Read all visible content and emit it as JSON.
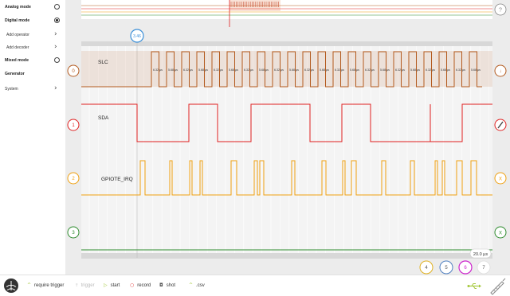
{
  "sidebar": {
    "items": [
      {
        "label": "Analog mode",
        "control": "radio",
        "selected": false,
        "bold": true
      },
      {
        "label": "Digital mode",
        "control": "radio",
        "selected": true,
        "bold": true
      },
      {
        "label": "Add operator",
        "control": "chevron",
        "bold": false
      },
      {
        "label": "Add decoder",
        "control": "chevron",
        "bold": false
      },
      {
        "label": "Mixed mode",
        "control": "radio",
        "selected": false,
        "bold": true
      },
      {
        "label": "Generator",
        "control": "none",
        "bold": true
      },
      {
        "label": "System",
        "control": "chevron",
        "bold": false
      }
    ]
  },
  "channels": [
    {
      "number": "0",
      "name": "SLC",
      "color": "#b35a1e"
    },
    {
      "number": "1",
      "name": "SDA",
      "color": "#e02020"
    },
    {
      "number": "2",
      "name": "GPIOTE_IRQ",
      "color": "#f0a010"
    },
    {
      "number": "3",
      "name": "",
      "color": "#2e8b2e"
    }
  ],
  "right_buttons": {
    "help": "?",
    "ch0": "↓",
    "ch2": "X",
    "ch3": "X"
  },
  "cursor_marker": "3.46",
  "pulse_labels": [
    "6.32 µs",
    "5.68 µs"
  ],
  "timebase": "20.0 µs",
  "channel_select": [
    "4",
    "5",
    "6",
    "7"
  ],
  "toolbar": {
    "require_trigger": "require trigger",
    "trigger": "trigger",
    "start": "start",
    "record": "record",
    "shot": "shot",
    "csv": ".csv"
  },
  "colors": {
    "slc": "#b35a1e",
    "sda": "#e02020",
    "gpio": "#f0a010",
    "ch3": "#2e8b2e",
    "marker": "#3a8fd8",
    "ch6": "#cc22cc",
    "ch5": "#4f7fc0",
    "ch4": "#e0b020",
    "accent": "#a5c83c"
  }
}
